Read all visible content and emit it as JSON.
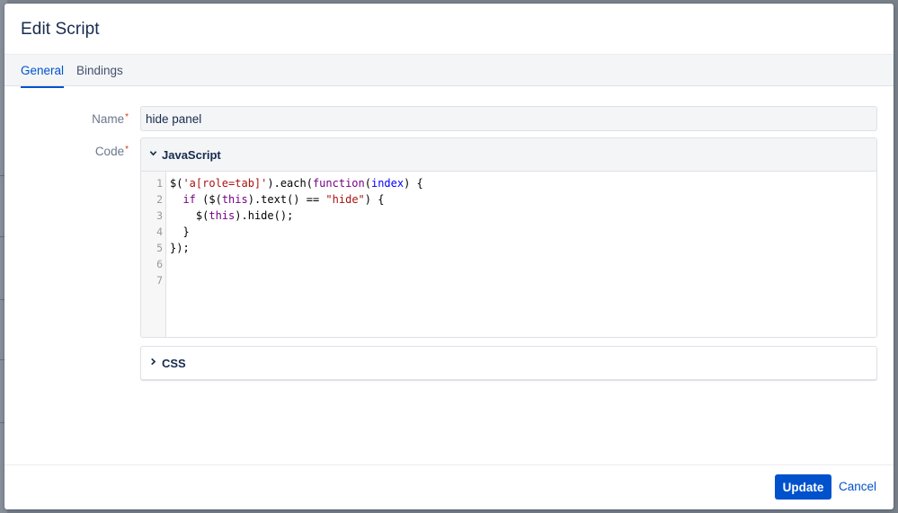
{
  "dialog": {
    "title": "Edit Script"
  },
  "tabs": [
    {
      "label": "General",
      "active": true
    },
    {
      "label": "Bindings",
      "active": false
    }
  ],
  "form": {
    "name_label": "Name",
    "name_value": "hide panel",
    "code_label": "Code",
    "required_marker": "*"
  },
  "javascript_panel": {
    "title": "JavaScript",
    "expanded": true,
    "icon": "chevron-down-icon",
    "lines": [
      {
        "num": "1",
        "tokens": [
          {
            "t": "$(",
            "c": "plain"
          },
          {
            "t": "'a[role=tab]'",
            "c": "str"
          },
          {
            "t": ").each(",
            "c": "plain"
          },
          {
            "t": "function",
            "c": "kw"
          },
          {
            "t": "(",
            "c": "plain"
          },
          {
            "t": "index",
            "c": "def"
          },
          {
            "t": ") {",
            "c": "plain"
          }
        ]
      },
      {
        "num": "2",
        "tokens": [
          {
            "t": "  ",
            "c": "plain"
          },
          {
            "t": "if",
            "c": "kw"
          },
          {
            "t": " ($(",
            "c": "plain"
          },
          {
            "t": "this",
            "c": "kw"
          },
          {
            "t": ").text() == ",
            "c": "plain"
          },
          {
            "t": "\"hide\"",
            "c": "str"
          },
          {
            "t": ") {",
            "c": "plain"
          }
        ]
      },
      {
        "num": "3",
        "tokens": [
          {
            "t": "    $(",
            "c": "plain"
          },
          {
            "t": "this",
            "c": "kw"
          },
          {
            "t": ").hide();",
            "c": "plain"
          }
        ]
      },
      {
        "num": "4",
        "tokens": [
          {
            "t": "  }",
            "c": "plain"
          }
        ]
      },
      {
        "num": "5",
        "tokens": [
          {
            "t": "});",
            "c": "plain"
          }
        ]
      },
      {
        "num": "6",
        "tokens": []
      },
      {
        "num": "7",
        "tokens": []
      }
    ]
  },
  "css_panel": {
    "title": "CSS",
    "expanded": false,
    "icon": "chevron-right-icon"
  },
  "footer": {
    "update_label": "Update",
    "cancel_label": "Cancel"
  },
  "colors": {
    "primary": "#0052cc",
    "required": "#de350b",
    "string": "#aa1111",
    "keyword": "#770088",
    "variable": "#0000ff"
  }
}
